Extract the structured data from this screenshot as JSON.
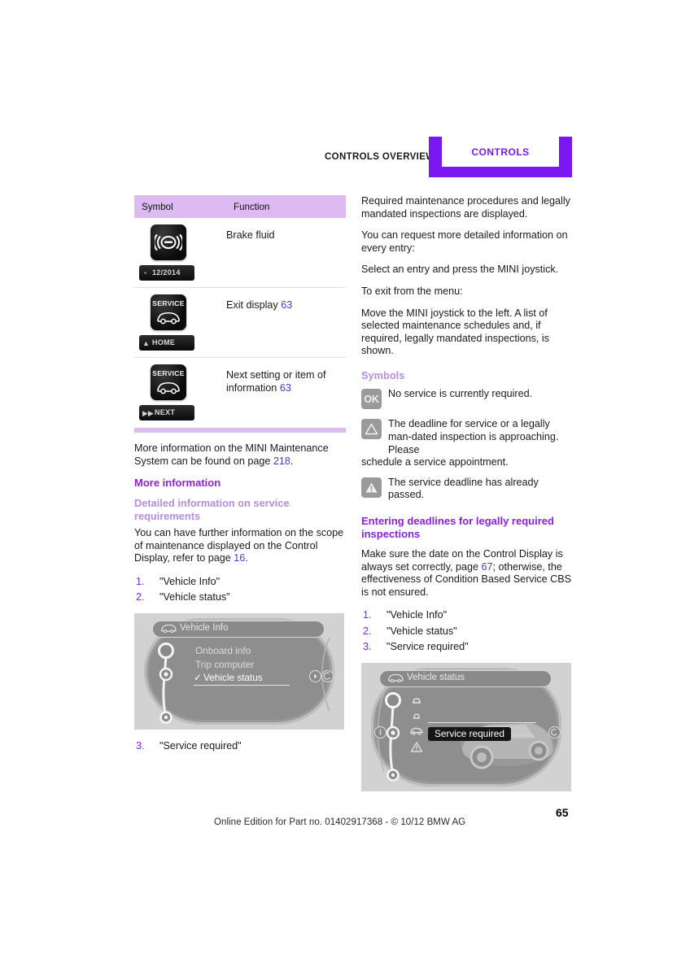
{
  "header": {
    "overview_label": "CONTROLS OVERVIEW",
    "section_label": "CONTROLS",
    "accent_color": "#7b17f0"
  },
  "left_column": {
    "table": {
      "columns": [
        "Symbol",
        "Function"
      ],
      "rows": [
        {
          "symbol": {
            "type": "brake-fluid-tile",
            "tile_label": "",
            "strip_label": "12/2014",
            "strip_icon": "clock-icon"
          },
          "function": "Brake fluid",
          "page_ref": ""
        },
        {
          "symbol": {
            "type": "service-car-tile",
            "tile_label": "SERVICE",
            "strip_label": "HOME",
            "strip_icon": "up-triangle-icon"
          },
          "function": "Exit display",
          "page_ref": "63"
        },
        {
          "symbol": {
            "type": "service-car-tile",
            "tile_label": "SERVICE",
            "strip_label": "NEXT",
            "strip_icon": "fast-forward-icon"
          },
          "function": "Next setting or item of information",
          "page_ref": "63"
        }
      ]
    },
    "after_table_text": {
      "part1": "More information on the MINI Maintenance System can be found on page ",
      "page_ref": "218",
      "part2": "."
    },
    "more_information_heading": "More information",
    "detailed_info_heading": "Detailed information on service requirements",
    "detailed_info_text": {
      "part1": "You can have further information on the scope of maintenance displayed on the Control Display, refer to page ",
      "page_ref": "16",
      "part2": "."
    },
    "steps_before_figure": [
      {
        "num": "1.",
        "label": "\"Vehicle Info\""
      },
      {
        "num": "2.",
        "label": "\"Vehicle status\""
      }
    ],
    "figure": {
      "title": "Vehicle Info",
      "menu_items": [
        "Onboard info",
        "Trip computer",
        "Vehicle status"
      ],
      "selected_item": "Vehicle status",
      "checkmark": "✓"
    },
    "steps_after_figure": [
      {
        "num": "3.",
        "label": "\"Service required\""
      }
    ]
  },
  "right_column": {
    "paragraphs": [
      "Required maintenance procedures and legally mandated inspections are displayed.",
      "You can request more detailed information on every entry:",
      "Select an entry and press the MINI joystick.",
      "To exit from the menu:",
      "Move the MINI joystick to the left. A list of selected maintenance schedules and, if required, legally mandated inspections, is shown."
    ],
    "symbols_heading": "Symbols",
    "symbols": [
      {
        "badge": "OK",
        "badge_type": "ok-badge",
        "text": "No service is currently required."
      },
      {
        "badge": "",
        "badge_type": "warning-triangle-outline-badge",
        "text_first": "The deadline for service or a legally man-dated inspection is approaching. Please",
        "text_rest": "schedule a service appointment.",
        "text": "The deadline for service or a legally mandated inspection is approaching. Please schedule a service appointment."
      },
      {
        "badge": "",
        "badge_type": "warning-triangle-filled-badge",
        "text": "The service deadline has already passed."
      }
    ],
    "entering_deadlines_heading": "Entering deadlines for legally required inspections",
    "entering_deadlines_text": {
      "part1": "Make sure the date on the Control Display is always set correctly, page ",
      "page_ref": "67",
      "part2": "; otherwise, the effectiveness of Condition Based Service CBS is not ensured."
    },
    "steps": [
      {
        "num": "1.",
        "label": "\"Vehicle Info\""
      },
      {
        "num": "2.",
        "label": "\"Vehicle status\""
      },
      {
        "num": "3.",
        "label": "\"Service required\""
      }
    ],
    "figure": {
      "title": "Vehicle status",
      "selected_box": "Service required"
    }
  },
  "footer": {
    "text": "Online Edition for Part no. 01402917368 - © 10/12 BMW AG",
    "page_number": "65"
  }
}
